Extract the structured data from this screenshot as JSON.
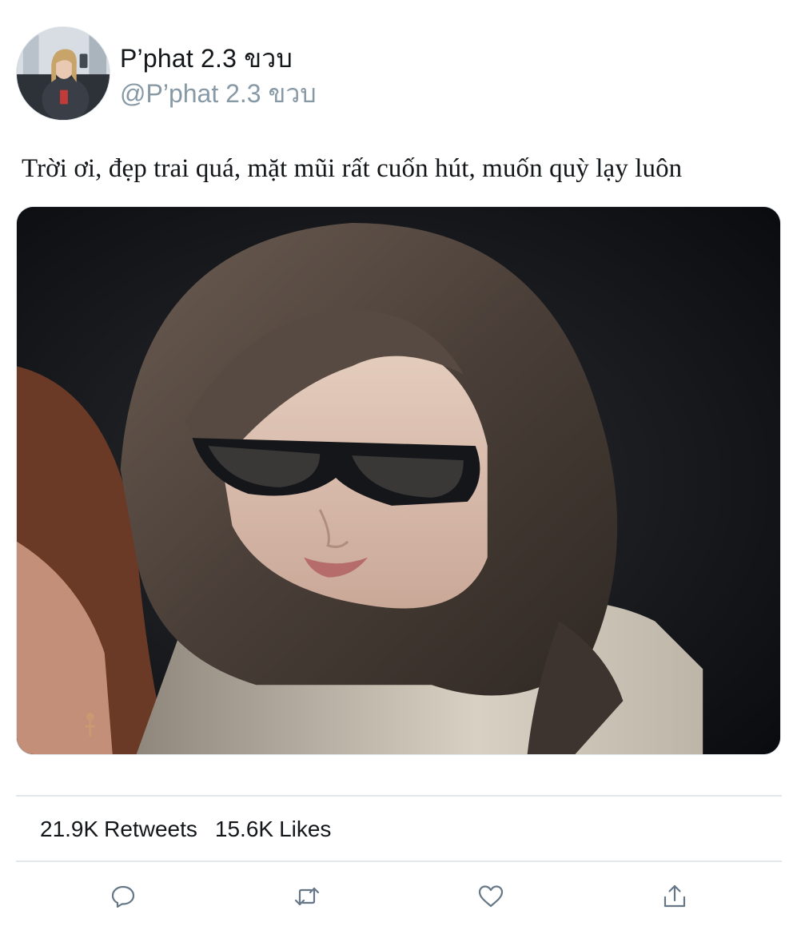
{
  "user": {
    "display_name": "P’phat 2.3 ขวบ",
    "handle": "@P’phat 2.3 ขวบ",
    "avatar_icon": "profile-photo"
  },
  "tweet": {
    "text": "Trời ơi, đẹp trai quá, mặt mũi rất cuốn hút, muốn quỳ lạy luôn",
    "media_icon": "photo"
  },
  "stats": {
    "retweets_count": "21.9K",
    "retweets_label": "Retweets",
    "likes_count": "15.6K",
    "likes_label": "Likes"
  },
  "actions": [
    {
      "icon": "reply-icon"
    },
    {
      "icon": "retweet-icon"
    },
    {
      "icon": "like-icon"
    },
    {
      "icon": "share-icon"
    }
  ],
  "colors": {
    "text_primary": "#14171a",
    "text_secondary": "#8899a6",
    "divider": "#e1e8ed",
    "icon": "#657786"
  }
}
